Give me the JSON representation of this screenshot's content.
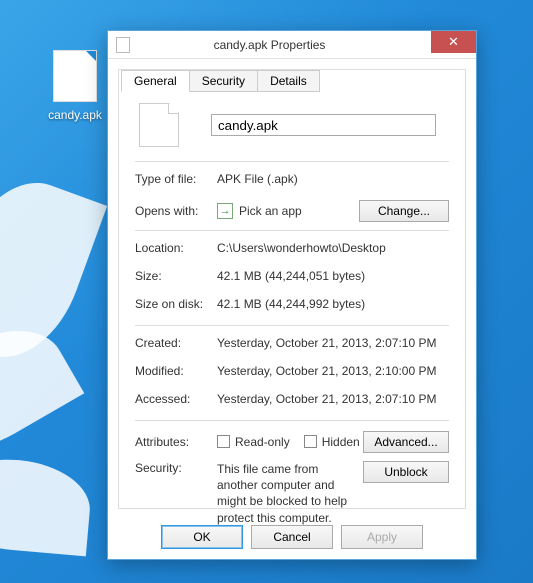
{
  "desktop": {
    "icon_label": "candy.apk"
  },
  "dialog": {
    "title": "candy.apk Properties",
    "tabs": {
      "general": "General",
      "security": "Security",
      "details": "Details"
    },
    "filename": "candy.apk",
    "rows": {
      "type_label": "Type of file:",
      "type_value": "APK File (.apk)",
      "opens_label": "Opens with:",
      "opens_value": "Pick an app",
      "change_btn": "Change...",
      "location_label": "Location:",
      "location_value": "C:\\Users\\wonderhowto\\Desktop",
      "size_label": "Size:",
      "size_value": "42.1 MB (44,244,051 bytes)",
      "sizeondisk_label": "Size on disk:",
      "sizeondisk_value": "42.1 MB (44,244,992 bytes)",
      "created_label": "Created:",
      "created_value": "Yesterday, October 21, 2013, 2:07:10 PM",
      "modified_label": "Modified:",
      "modified_value": "Yesterday, October 21, 2013, 2:10:00 PM",
      "accessed_label": "Accessed:",
      "accessed_value": "Yesterday, October 21, 2013, 2:07:10 PM",
      "attributes_label": "Attributes:",
      "readonly_label": "Read-only",
      "hidden_label": "Hidden",
      "advanced_btn": "Advanced...",
      "security_label": "Security:",
      "security_text": "This file came from another computer and might be blocked to help protect this computer.",
      "unblock_btn": "Unblock"
    },
    "footer": {
      "ok": "OK",
      "cancel": "Cancel",
      "apply": "Apply"
    }
  }
}
